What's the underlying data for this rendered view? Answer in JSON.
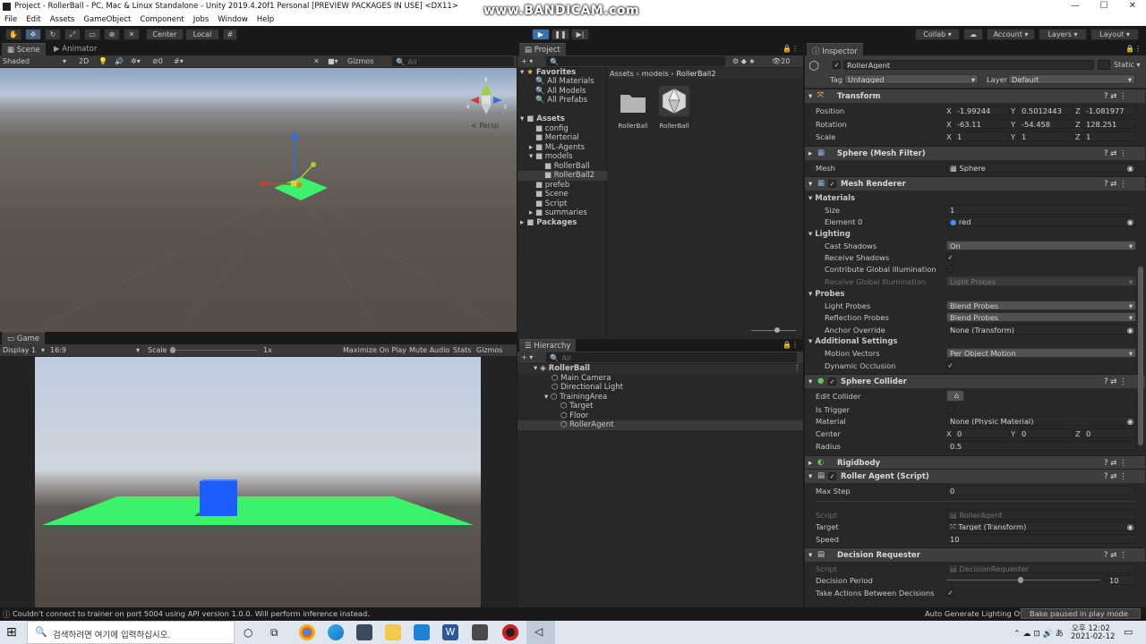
{
  "window": {
    "title": "Project - RollerBall - PC, Mac & Linux Standalone - Unity 2019.4.20f1 Personal [PREVIEW PACKAGES IN USE] <DX11>",
    "watermark": "www.BANDICAM.com",
    "min": "—",
    "max": "☐",
    "close": "✕"
  },
  "menu": [
    "File",
    "Edit",
    "Assets",
    "GameObject",
    "Component",
    "Jobs",
    "Window",
    "Help"
  ],
  "toolbar": {
    "center": "Center",
    "local": "Local",
    "collab": "Collab ▾",
    "account": "Account",
    "layers": "Layers",
    "layout": "Layout"
  },
  "scene": {
    "tabs": [
      "Scene",
      "Animator"
    ],
    "shading": "Shaded",
    "mode2d": "2D",
    "fx_count": "0",
    "gizmos": "Gizmos",
    "search_placeholder": "All",
    "persp": "< Persp",
    "axes": {
      "x": "x",
      "y": "y",
      "z": "z"
    }
  },
  "game": {
    "tab": "Game",
    "display": "Display 1",
    "aspect": "16:9",
    "scale_label": "Scale",
    "scale_value": "1x",
    "buttons": [
      "Maximize On Play",
      "Mute Audio",
      "Stats",
      "Gizmos"
    ]
  },
  "project": {
    "tab": "Project",
    "count": "20",
    "favorites": {
      "label": "Favorites",
      "items": [
        "All Materials",
        "All Models",
        "All Prefabs"
      ]
    },
    "assets": {
      "label": "Assets",
      "items": [
        "config",
        "Merterial",
        "ML-Agents",
        "models",
        "RollerBall",
        "RollerBall2",
        "prefeb",
        "Scene",
        "Script",
        "summaries"
      ]
    },
    "packages": "Packages",
    "breadcrumb": [
      "Assets",
      "models",
      "RollerBall2"
    ],
    "files": [
      {
        "name": "RollerBall",
        "icon": "folder-icon"
      },
      {
        "name": "RollerBall",
        "icon": "mesh-icon"
      }
    ]
  },
  "hierarchy": {
    "tab": "Hierarchy",
    "search_placeholder": "All",
    "scene_name": "RollerBall",
    "items": [
      "Main Camera",
      "Directional Light",
      "TrainingArea",
      "Target",
      "Floor",
      "RollerAgent"
    ]
  },
  "inspector": {
    "tab": "Inspector",
    "object_name": "RollerAgent",
    "static": "Static ▾",
    "tag_label": "Tag",
    "tag": "Untagged",
    "layer_label": "Layer",
    "layer": "Default",
    "transform": {
      "title": "Transform",
      "position": {
        "label": "Position",
        "x": "-1.99244",
        "y": "0.5012443",
        "z": "-1.081977"
      },
      "rotation": {
        "label": "Rotation",
        "x": "-63.11",
        "y": "-54.458",
        "z": "128.251"
      },
      "scale": {
        "label": "Scale",
        "x": "1",
        "y": "1",
        "z": "1"
      }
    },
    "mesh_filter": {
      "title": "Sphere (Mesh Filter)",
      "mesh_label": "Mesh",
      "mesh": "Sphere"
    },
    "mesh_renderer": {
      "title": "Mesh Renderer",
      "materials": "Materials",
      "size_label": "Size",
      "size": "1",
      "element_label": "Element 0",
      "element": "red",
      "lighting": "Lighting",
      "cast_label": "Cast Shadows",
      "cast": "On",
      "receive_label": "Receive Shadows",
      "contrib_label": "Contribute Global Illumination",
      "recv_gi_label": "Receive Global Illumination",
      "recv_gi": "Light Probes",
      "probes": "Probes",
      "light_probes_label": "Light Probes",
      "light_probes": "Blend Probes",
      "refl_label": "Reflection Probes",
      "refl": "Blend Probes",
      "anchor_label": "Anchor Override",
      "anchor": "None (Transform)",
      "additional": "Additional Settings",
      "motion_label": "Motion Vectors",
      "motion": "Per Object Motion",
      "dynocc_label": "Dynamic Occlusion"
    },
    "sphere_collider": {
      "title": "Sphere Collider",
      "edit_label": "Edit Collider",
      "trigger_label": "Is Trigger",
      "material_label": "Material",
      "material": "None (Physic Material)",
      "center_label": "Center",
      "cx": "0",
      "cy": "0",
      "cz": "0",
      "radius_label": "Radius",
      "radius": "0.5"
    },
    "rigidbody": {
      "title": "Rigidbody"
    },
    "roller_agent": {
      "title": "Roller Agent (Script)",
      "maxstep_label": "Max Step",
      "maxstep": "0",
      "script_label": "Script",
      "script": "RollerAgent",
      "target_label": "Target",
      "target": "Target (Transform)",
      "speed_label": "Speed",
      "speed": "10"
    },
    "decision": {
      "title": "Decision Requester",
      "script_label": "Script",
      "script": "DecisionRequester",
      "period_label": "Decision Period",
      "period": "10",
      "take_label": "Take Actions Between Decisions"
    }
  },
  "status": {
    "message": "Couldn't connect to trainer on port 5004 using API version 1.0.0. Will perform inference instead.",
    "auto": "Auto Generate Lighting Off",
    "bake": "Bake paused in play mode"
  },
  "taskbar": {
    "search": "검색하려면 여기에 입력하십시오.",
    "time": "오후 12:02",
    "date": "2021-02-12"
  },
  "colors": {
    "accent": "#3a72b0",
    "floor": "#3cf26a",
    "cube": "#1e5cff",
    "sky_top": "#9fb6d6",
    "ground": "#5b524b"
  }
}
